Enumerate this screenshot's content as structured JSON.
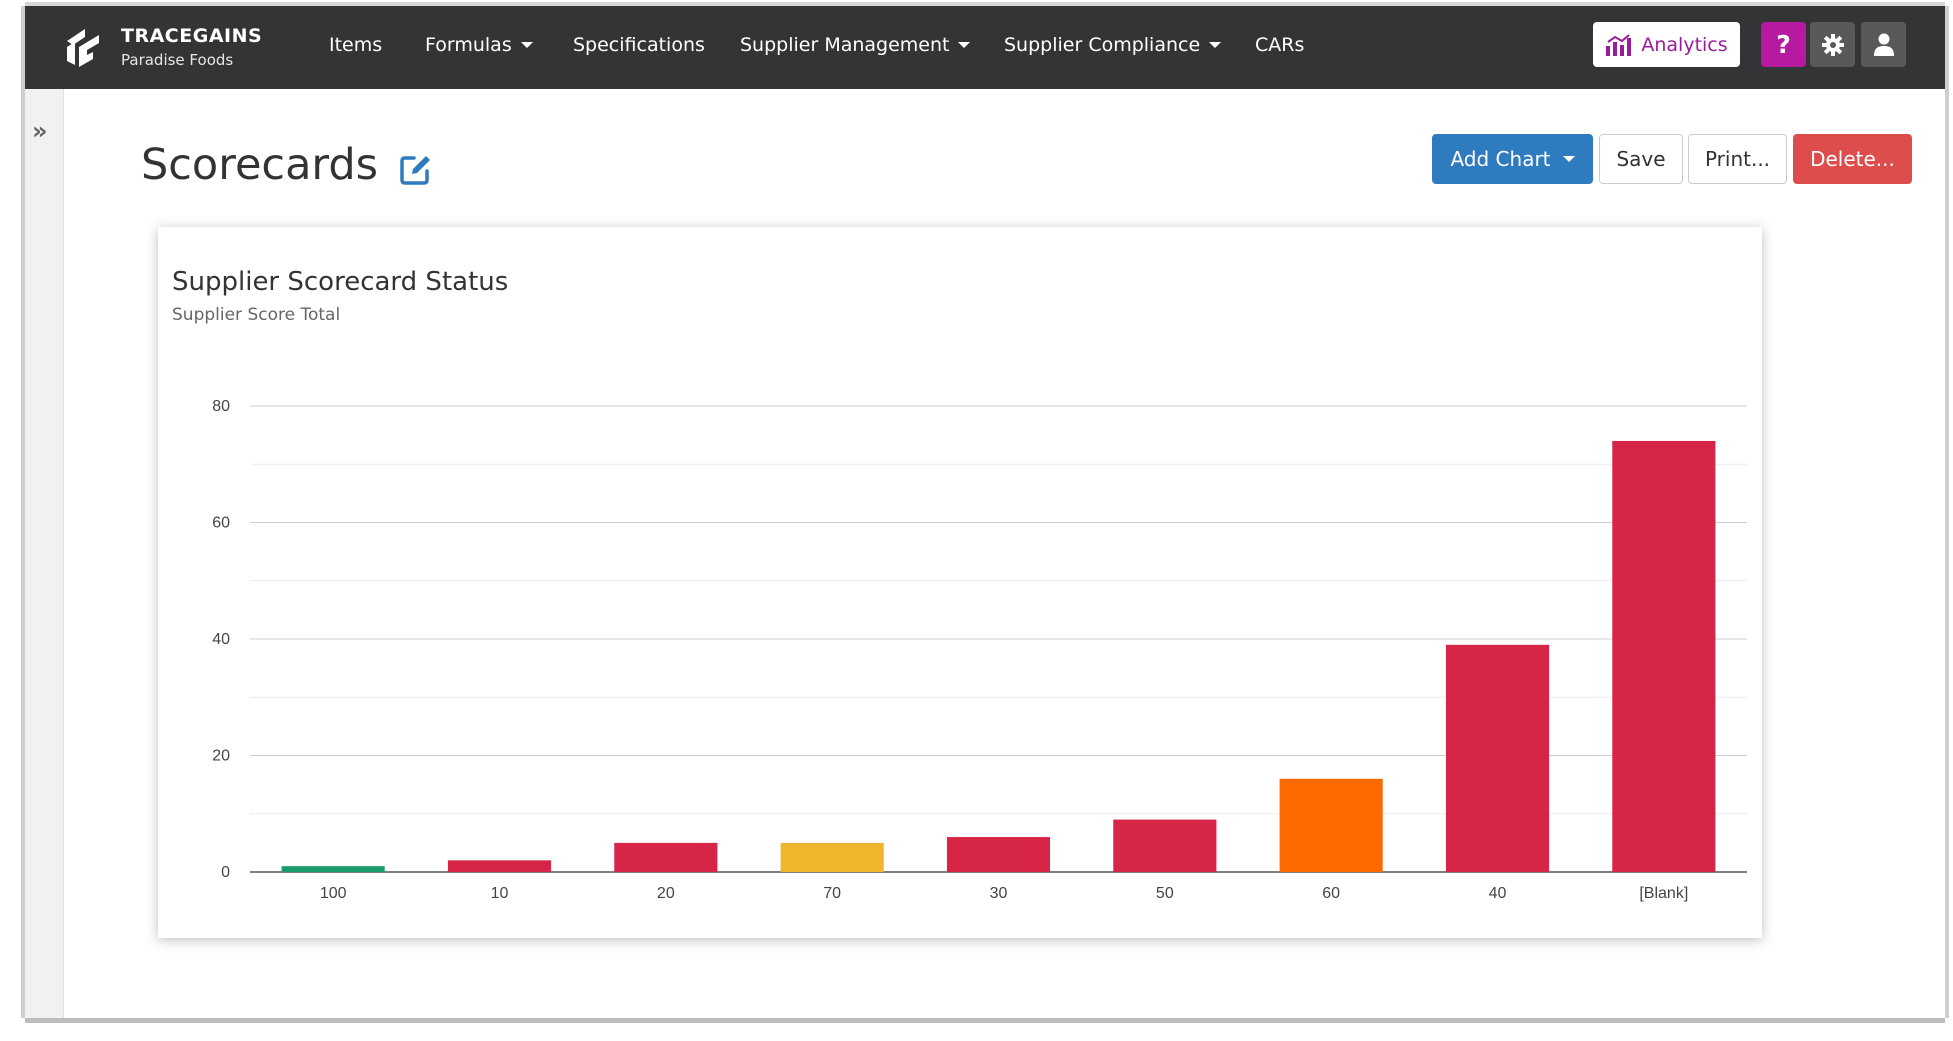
{
  "navbar": {
    "brand_title": "TRACEGAINS",
    "brand_subtitle": "Paradise Foods",
    "items": [
      {
        "label": "Items",
        "dropdown": false
      },
      {
        "label": "Formulas",
        "dropdown": true
      },
      {
        "label": "Specifications",
        "dropdown": false
      },
      {
        "label": "Supplier Management",
        "dropdown": true
      },
      {
        "label": "Supplier Compliance",
        "dropdown": true
      },
      {
        "label": "CARs",
        "dropdown": false
      }
    ],
    "analytics_label": "Analytics",
    "help_label": "?"
  },
  "sidebar": {
    "toggle_label": "»"
  },
  "page": {
    "title": "Scorecards",
    "actions": {
      "add_chart": "Add Chart",
      "save": "Save",
      "print": "Print...",
      "delete": "Delete..."
    }
  },
  "colors": {
    "navbar_bg": "#323436",
    "primary": "#2f7bbf",
    "danger": "#dc4d4c",
    "analytics": "#9b1c9a",
    "help": "#b51aa0",
    "bar_red": "#d62546",
    "bar_green": "#1b9a6b",
    "bar_yellow": "#efb52c",
    "bar_orange": "#ff6a00"
  },
  "chart_data": {
    "type": "bar",
    "title": "Supplier Scorecard Status",
    "subtitle": "Supplier Score Total",
    "categories": [
      "100",
      "10",
      "20",
      "70",
      "30",
      "50",
      "60",
      "40",
      "[Blank]"
    ],
    "values": [
      1,
      2,
      5,
      5,
      6,
      9,
      16,
      39,
      74
    ],
    "bar_colors": [
      "#1b9a6b",
      "#d62546",
      "#d62546",
      "#efb52c",
      "#d62546",
      "#d62546",
      "#ff6a00",
      "#d62546",
      "#d62546"
    ],
    "ylim": [
      0,
      80
    ],
    "yticks": [
      0,
      20,
      40,
      60,
      80
    ],
    "grid": true,
    "legend": "none"
  }
}
